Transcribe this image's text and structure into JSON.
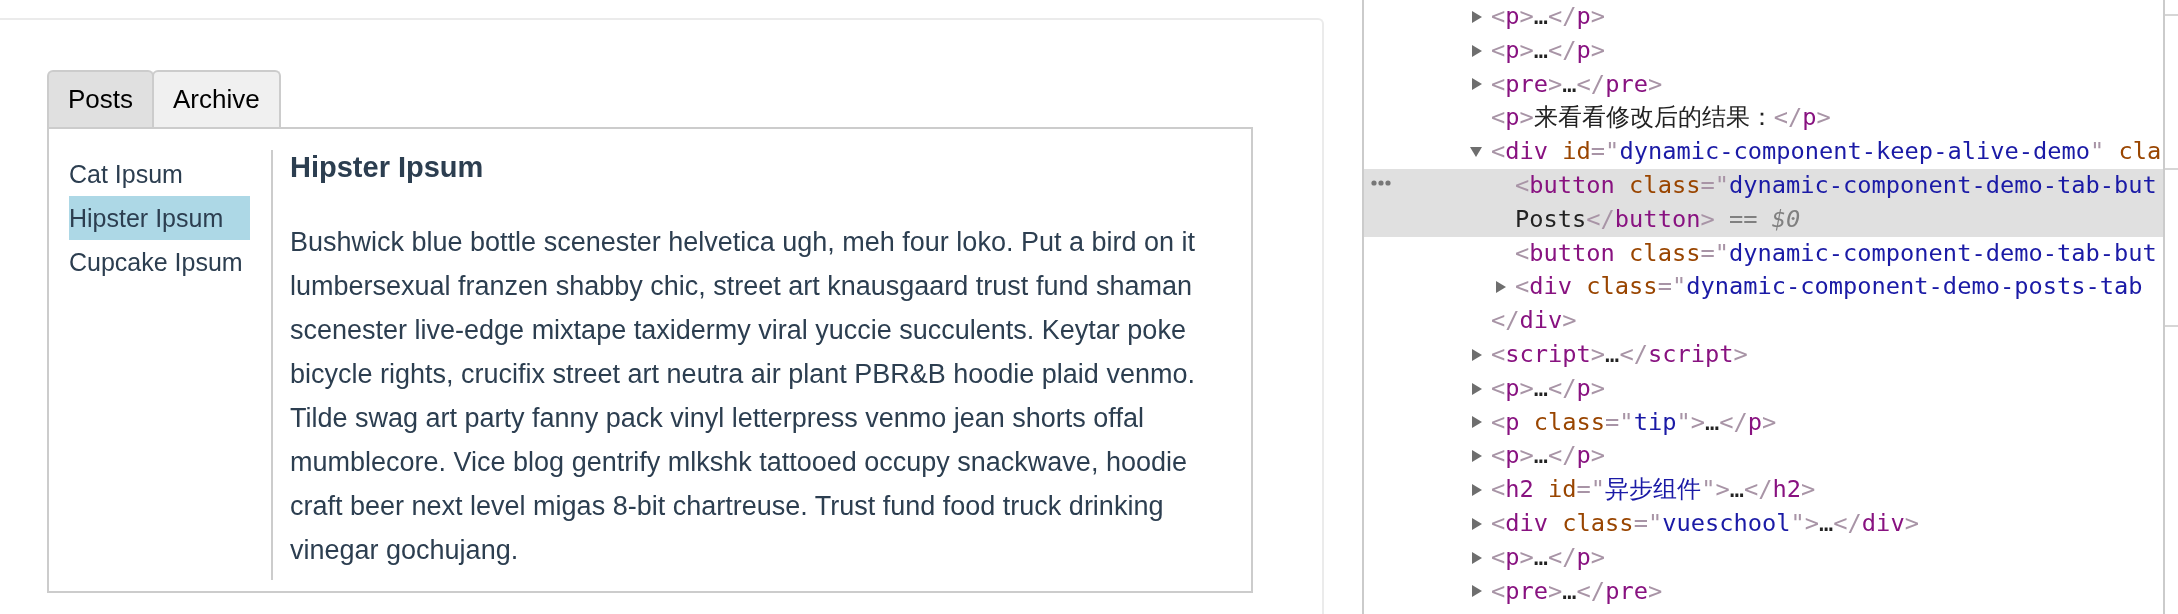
{
  "page": {
    "tabs": [
      {
        "label": "Posts",
        "selected": true
      },
      {
        "label": "Archive",
        "selected": false
      }
    ],
    "posts": [
      {
        "title": "Cat Ipsum",
        "selected": false
      },
      {
        "title": "Hipster Ipsum",
        "selected": true
      },
      {
        "title": "Cupcake Ipsum",
        "selected": false
      }
    ],
    "post": {
      "title": "Hipster Ipsum",
      "body": "Bushwick blue bottle scenester helvetica ugh, meh four loko. Put a bird on it lumbersexual franzen shabby chic, street art knausgaard trust fund shaman scenester live-edge mixtape taxidermy viral yuccie succulents. Keytar poke bicycle rights, crucifix street art neutra air plant PBR&B hoodie plaid venmo. Tilde swag art party fanny pack vinyl letterpress venmo jean shorts offal mumblecore. Vice blog gentrify mlkshk tattooed occupy snackwave, hoodie craft beer next level migas 8-bit chartreuse. Trust fund food truck drinking vinegar gochujang."
    }
  },
  "devtools": {
    "dom_tree": [
      {
        "selected": false,
        "expanded": false,
        "lines": [
          [
            {
              "kind": "punct",
              "text": "<"
            },
            {
              "kind": "tag",
              "text": "p"
            },
            {
              "kind": "punct",
              "text": ">"
            },
            {
              "kind": "text",
              "text": "…"
            },
            {
              "kind": "punct",
              "text": "</"
            },
            {
              "kind": "tag",
              "text": "p"
            },
            {
              "kind": "punct",
              "text": ">"
            }
          ]
        ]
      },
      {
        "selected": false,
        "expanded": false,
        "lines": [
          [
            {
              "kind": "punct",
              "text": "<"
            },
            {
              "kind": "tag",
              "text": "p"
            },
            {
              "kind": "punct",
              "text": ">"
            },
            {
              "kind": "text",
              "text": "…"
            },
            {
              "kind": "punct",
              "text": "</"
            },
            {
              "kind": "tag",
              "text": "p"
            },
            {
              "kind": "punct",
              "text": ">"
            }
          ]
        ]
      },
      {
        "selected": false,
        "expanded": false,
        "lines": [
          [
            {
              "kind": "punct",
              "text": "<"
            },
            {
              "kind": "tag",
              "text": "pre"
            },
            {
              "kind": "punct",
              "text": ">"
            },
            {
              "kind": "text",
              "text": "…"
            },
            {
              "kind": "punct",
              "text": "</"
            },
            {
              "kind": "tag",
              "text": "pre"
            },
            {
              "kind": "punct",
              "text": ">"
            }
          ]
        ]
      },
      {
        "selected": false,
        "lines": [
          [
            {
              "kind": "punct",
              "text": "<"
            },
            {
              "kind": "tag",
              "text": "p"
            },
            {
              "kind": "punct",
              "text": ">"
            },
            {
              "kind": "text",
              "text": "来看看修改后的结果："
            },
            {
              "kind": "punct",
              "text": "</"
            },
            {
              "kind": "tag",
              "text": "p"
            },
            {
              "kind": "punct",
              "text": ">"
            }
          ]
        ]
      },
      {
        "selected": false,
        "expanded": true,
        "lines": [
          [
            {
              "kind": "punct",
              "text": "<"
            },
            {
              "kind": "tag",
              "text": "div"
            },
            {
              "kind": "attr",
              "text": " id"
            },
            {
              "kind": "punct",
              "text": "=\""
            },
            {
              "kind": "value",
              "text": "dynamic-component-keep-alive-demo"
            },
            {
              "kind": "punct",
              "text": "\""
            },
            {
              "kind": "attr",
              "text": " cla"
            }
          ]
        ],
        "children": [
          {
            "selected": true,
            "lines": [
              [
                {
                  "kind": "punct",
                  "text": "<"
                },
                {
                  "kind": "tag",
                  "text": "button"
                },
                {
                  "kind": "attr",
                  "text": " class"
                },
                {
                  "kind": "punct",
                  "text": "=\""
                },
                {
                  "kind": "value",
                  "text": "dynamic-component-demo-tab-but"
                }
              ],
              [
                {
                  "kind": "text",
                  "text": "Posts"
                },
                {
                  "kind": "punct",
                  "text": "</"
                },
                {
                  "kind": "tag",
                  "text": "button"
                },
                {
                  "kind": "punct",
                  "text": ">"
                },
                {
                  "kind": "note",
                  "text": " =="
                },
                {
                  "kind": "var",
                  "text": " $0"
                }
              ]
            ]
          },
          {
            "selected": false,
            "lines": [
              [
                {
                  "kind": "punct",
                  "text": "<"
                },
                {
                  "kind": "tag",
                  "text": "button"
                },
                {
                  "kind": "attr",
                  "text": " class"
                },
                {
                  "kind": "punct",
                  "text": "=\""
                },
                {
                  "kind": "value",
                  "text": "dynamic-component-demo-tab-but"
                }
              ]
            ]
          },
          {
            "selected": false,
            "expanded": false,
            "lines": [
              [
                {
                  "kind": "punct",
                  "text": "<"
                },
                {
                  "kind": "tag",
                  "text": "div"
                },
                {
                  "kind": "attr",
                  "text": " class"
                },
                {
                  "kind": "punct",
                  "text": "=\""
                },
                {
                  "kind": "value",
                  "text": "dynamic-component-demo-posts-tab"
                }
              ]
            ]
          }
        ],
        "closing": [
          {
            "kind": "punct",
            "text": "</"
          },
          {
            "kind": "tag",
            "text": "div"
          },
          {
            "kind": "punct",
            "text": ">"
          }
        ]
      },
      {
        "selected": false,
        "expanded": false,
        "lines": [
          [
            {
              "kind": "punct",
              "text": "<"
            },
            {
              "kind": "tag",
              "text": "script"
            },
            {
              "kind": "punct",
              "text": ">"
            },
            {
              "kind": "text",
              "text": "…"
            },
            {
              "kind": "punct",
              "text": "</"
            },
            {
              "kind": "tag",
              "text": "script"
            },
            {
              "kind": "punct",
              "text": ">"
            }
          ]
        ]
      },
      {
        "selected": false,
        "expanded": false,
        "lines": [
          [
            {
              "kind": "punct",
              "text": "<"
            },
            {
              "kind": "tag",
              "text": "p"
            },
            {
              "kind": "punct",
              "text": ">"
            },
            {
              "kind": "text",
              "text": "…"
            },
            {
              "kind": "punct",
              "text": "</"
            },
            {
              "kind": "tag",
              "text": "p"
            },
            {
              "kind": "punct",
              "text": ">"
            }
          ]
        ]
      },
      {
        "selected": false,
        "expanded": false,
        "lines": [
          [
            {
              "kind": "punct",
              "text": "<"
            },
            {
              "kind": "tag",
              "text": "p"
            },
            {
              "kind": "attr",
              "text": " class"
            },
            {
              "kind": "punct",
              "text": "=\""
            },
            {
              "kind": "value",
              "text": "tip"
            },
            {
              "kind": "punct",
              "text": "\">"
            },
            {
              "kind": "text",
              "text": "…"
            },
            {
              "kind": "punct",
              "text": "</"
            },
            {
              "kind": "tag",
              "text": "p"
            },
            {
              "kind": "punct",
              "text": ">"
            }
          ]
        ]
      },
      {
        "selected": false,
        "expanded": false,
        "lines": [
          [
            {
              "kind": "punct",
              "text": "<"
            },
            {
              "kind": "tag",
              "text": "p"
            },
            {
              "kind": "punct",
              "text": ">"
            },
            {
              "kind": "text",
              "text": "…"
            },
            {
              "kind": "punct",
              "text": "</"
            },
            {
              "kind": "tag",
              "text": "p"
            },
            {
              "kind": "punct",
              "text": ">"
            }
          ]
        ]
      },
      {
        "selected": false,
        "expanded": false,
        "lines": [
          [
            {
              "kind": "punct",
              "text": "<"
            },
            {
              "kind": "tag",
              "text": "h2"
            },
            {
              "kind": "attr",
              "text": " id"
            },
            {
              "kind": "punct",
              "text": "=\""
            },
            {
              "kind": "value",
              "text": "异步组件"
            },
            {
              "kind": "punct",
              "text": "\">"
            },
            {
              "kind": "text",
              "text": "…"
            },
            {
              "kind": "punct",
              "text": "</"
            },
            {
              "kind": "tag",
              "text": "h2"
            },
            {
              "kind": "punct",
              "text": ">"
            }
          ]
        ]
      },
      {
        "selected": false,
        "expanded": false,
        "lines": [
          [
            {
              "kind": "punct",
              "text": "<"
            },
            {
              "kind": "tag",
              "text": "div"
            },
            {
              "kind": "attr",
              "text": " class"
            },
            {
              "kind": "punct",
              "text": "=\""
            },
            {
              "kind": "value",
              "text": "vueschool"
            },
            {
              "kind": "punct",
              "text": "\">"
            },
            {
              "kind": "text",
              "text": "…"
            },
            {
              "kind": "punct",
              "text": "</"
            },
            {
              "kind": "tag",
              "text": "div"
            },
            {
              "kind": "punct",
              "text": ">"
            }
          ]
        ]
      },
      {
        "selected": false,
        "expanded": false,
        "lines": [
          [
            {
              "kind": "punct",
              "text": "<"
            },
            {
              "kind": "tag",
              "text": "p"
            },
            {
              "kind": "punct",
              "text": ">"
            },
            {
              "kind": "text",
              "text": "…"
            },
            {
              "kind": "punct",
              "text": "</"
            },
            {
              "kind": "tag",
              "text": "p"
            },
            {
              "kind": "punct",
              "text": ">"
            }
          ]
        ]
      },
      {
        "selected": false,
        "expanded": false,
        "lines": [
          [
            {
              "kind": "punct",
              "text": "<"
            },
            {
              "kind": "tag",
              "text": "pre"
            },
            {
              "kind": "punct",
              "text": ">"
            },
            {
              "kind": "text",
              "text": "…"
            },
            {
              "kind": "punct",
              "text": "</"
            },
            {
              "kind": "tag",
              "text": "pre"
            },
            {
              "kind": "punct",
              "text": ">"
            }
          ]
        ]
      }
    ]
  }
}
